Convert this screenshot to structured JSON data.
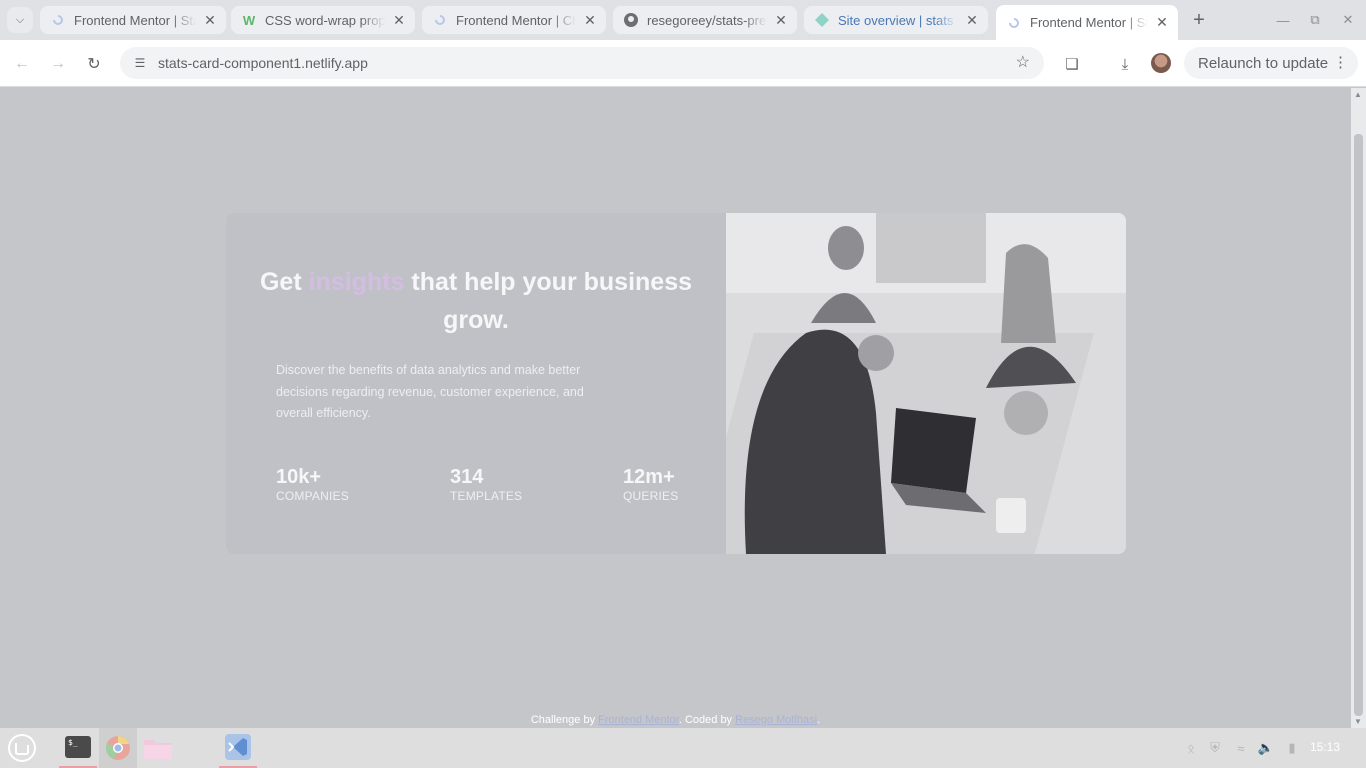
{
  "browser": {
    "tabs": [
      {
        "title": "Frontend Mentor | Stats",
        "icon": "frontend-mentor-icon",
        "active": false
      },
      {
        "title": "CSS word-wrap property",
        "icon": "w3schools-icon",
        "active": false
      },
      {
        "title": "Frontend Mentor | Challenges",
        "icon": "frontend-mentor-icon",
        "active": false
      },
      {
        "title": "resegoreey/stats-preview",
        "icon": "github-icon",
        "active": false
      },
      {
        "title": "Site overview | stats",
        "icon": "netlify-icon",
        "active": false
      },
      {
        "title": "Frontend Mentor | Stats",
        "icon": "frontend-mentor-icon",
        "active": true
      }
    ],
    "url": "stats-card-component1.netlify.app",
    "relaunch_label": "Relaunch to update"
  },
  "page": {
    "headline_prefix": "Get ",
    "headline_accent": "insights",
    "headline_suffix": " that help your business grow.",
    "description": "Discover the benefits of data analytics and make better decisions regarding revenue, customer experience, and overall efficiency.",
    "stats": [
      {
        "value": "10k+",
        "label": "COMPANIES"
      },
      {
        "value": "314",
        "label": "TEMPLATES"
      },
      {
        "value": "12m+",
        "label": "QUERIES"
      }
    ],
    "attribution": {
      "prefix": "Challenge by ",
      "link1": "Frontend Mentor",
      "middle": ". Coded by ",
      "link2": "Resego Motlhasi",
      "suffix": "."
    }
  },
  "taskbar": {
    "clock": "15:13",
    "apps": [
      "terminal-icon",
      "chrome-icon",
      "files-icon",
      "vscode-icon"
    ]
  },
  "colors": {
    "accent": "#d4bde2",
    "overlay": "#c5c6ca"
  }
}
